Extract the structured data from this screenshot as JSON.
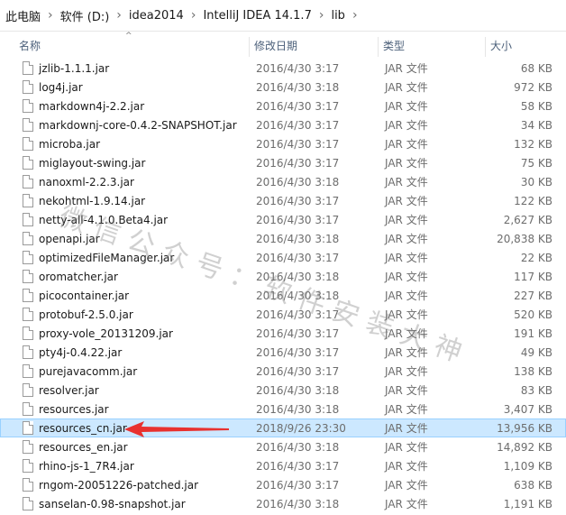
{
  "breadcrumb": [
    "此电脑",
    "软件 (D:)",
    "idea2014",
    "IntelliJ IDEA 14.1.7",
    "lib"
  ],
  "columns": {
    "name": "名称",
    "date": "修改日期",
    "type": "类型",
    "size": "大小"
  },
  "files": [
    {
      "name": "jzlib-1.1.1.jar",
      "date": "2016/4/30 3:17",
      "type": "JAR 文件",
      "size": "68 KB"
    },
    {
      "name": "log4j.jar",
      "date": "2016/4/30 3:18",
      "type": "JAR 文件",
      "size": "972 KB"
    },
    {
      "name": "markdown4j-2.2.jar",
      "date": "2016/4/30 3:17",
      "type": "JAR 文件",
      "size": "58 KB"
    },
    {
      "name": "markdownj-core-0.4.2-SNAPSHOT.jar",
      "date": "2016/4/30 3:17",
      "type": "JAR 文件",
      "size": "34 KB"
    },
    {
      "name": "microba.jar",
      "date": "2016/4/30 3:17",
      "type": "JAR 文件",
      "size": "132 KB"
    },
    {
      "name": "miglayout-swing.jar",
      "date": "2016/4/30 3:17",
      "type": "JAR 文件",
      "size": "75 KB"
    },
    {
      "name": "nanoxml-2.2.3.jar",
      "date": "2016/4/30 3:18",
      "type": "JAR 文件",
      "size": "30 KB"
    },
    {
      "name": "nekohtml-1.9.14.jar",
      "date": "2016/4/30 3:17",
      "type": "JAR 文件",
      "size": "122 KB"
    },
    {
      "name": "netty-all-4.1.0.Beta4.jar",
      "date": "2016/4/30 3:17",
      "type": "JAR 文件",
      "size": "2,627 KB"
    },
    {
      "name": "openapi.jar",
      "date": "2016/4/30 3:18",
      "type": "JAR 文件",
      "size": "20,838 KB"
    },
    {
      "name": "optimizedFileManager.jar",
      "date": "2016/4/30 3:17",
      "type": "JAR 文件",
      "size": "22 KB"
    },
    {
      "name": "oromatcher.jar",
      "date": "2016/4/30 3:18",
      "type": "JAR 文件",
      "size": "117 KB"
    },
    {
      "name": "picocontainer.jar",
      "date": "2016/4/30 3:18",
      "type": "JAR 文件",
      "size": "227 KB"
    },
    {
      "name": "protobuf-2.5.0.jar",
      "date": "2016/4/30 3:17",
      "type": "JAR 文件",
      "size": "520 KB"
    },
    {
      "name": "proxy-vole_20131209.jar",
      "date": "2016/4/30 3:17",
      "type": "JAR 文件",
      "size": "191 KB"
    },
    {
      "name": "pty4j-0.4.22.jar",
      "date": "2016/4/30 3:17",
      "type": "JAR 文件",
      "size": "49 KB"
    },
    {
      "name": "purejavacomm.jar",
      "date": "2016/4/30 3:17",
      "type": "JAR 文件",
      "size": "138 KB"
    },
    {
      "name": "resolver.jar",
      "date": "2016/4/30 3:18",
      "type": "JAR 文件",
      "size": "83 KB"
    },
    {
      "name": "resources.jar",
      "date": "2016/4/30 3:18",
      "type": "JAR 文件",
      "size": "3,407 KB"
    },
    {
      "name": "resources_cn.jar",
      "date": "2018/9/26 23:30",
      "type": "JAR 文件",
      "size": "13,956 KB"
    },
    {
      "name": "resources_en.jar",
      "date": "2016/4/30 3:18",
      "type": "JAR 文件",
      "size": "14,892 KB"
    },
    {
      "name": "rhino-js-1_7R4.jar",
      "date": "2016/4/30 3:17",
      "type": "JAR 文件",
      "size": "1,109 KB"
    },
    {
      "name": "rngom-20051226-patched.jar",
      "date": "2016/4/30 3:17",
      "type": "JAR 文件",
      "size": "638 KB"
    },
    {
      "name": "sanselan-0.98-snapshot.jar",
      "date": "2016/4/30 3:18",
      "type": "JAR 文件",
      "size": "1,191 KB"
    }
  ],
  "selected_index": 19,
  "watermark": "微信公众号：软件安装大神",
  "colors": {
    "selection_bg": "#cce8ff",
    "selection_border": "#99d1ff",
    "arrow": "#e8312f"
  }
}
